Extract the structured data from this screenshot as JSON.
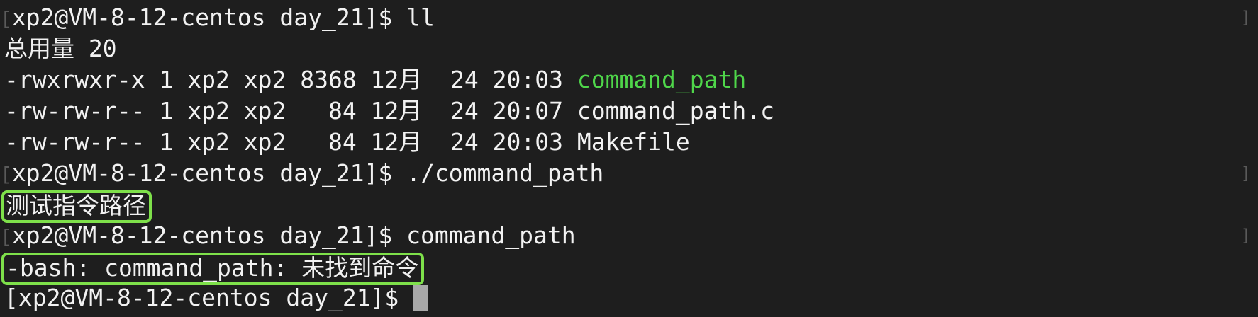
{
  "terminal": {
    "lines": [
      {
        "prefix": "[",
        "text": "xp2@VM-8-12-centos day_21]$ ll"
      },
      {
        "text": "总用量 20"
      },
      {
        "text": "-rwxrwxr-x 1 xp2 xp2 8368 12月  24 20:03 ",
        "highlight": "command_path"
      },
      {
        "text": "-rw-rw-r-- 1 xp2 xp2   84 12月  24 20:07 command_path.c"
      },
      {
        "text": "-rw-rw-r-- 1 xp2 xp2   84 12月  24 20:03 Makefile"
      },
      {
        "prefix": "[",
        "text": "xp2@VM-8-12-centos day_21]$ ./command_path"
      },
      {
        "boxed": "测试指令路径"
      },
      {
        "prefix": "[",
        "text": "xp2@VM-8-12-centos day_21]$ command_path"
      },
      {
        "boxed": "-bash: command_path: 未找到命令"
      },
      {
        "text": "[xp2@VM-8-12-centos day_21]$"
      }
    ],
    "colors": {
      "background": "#1e1e1e",
      "foreground": "#f2f2f2",
      "executable": "#4fd64a",
      "highlight_box": "#7ee04a",
      "cursor": "#a8a8a8"
    }
  }
}
